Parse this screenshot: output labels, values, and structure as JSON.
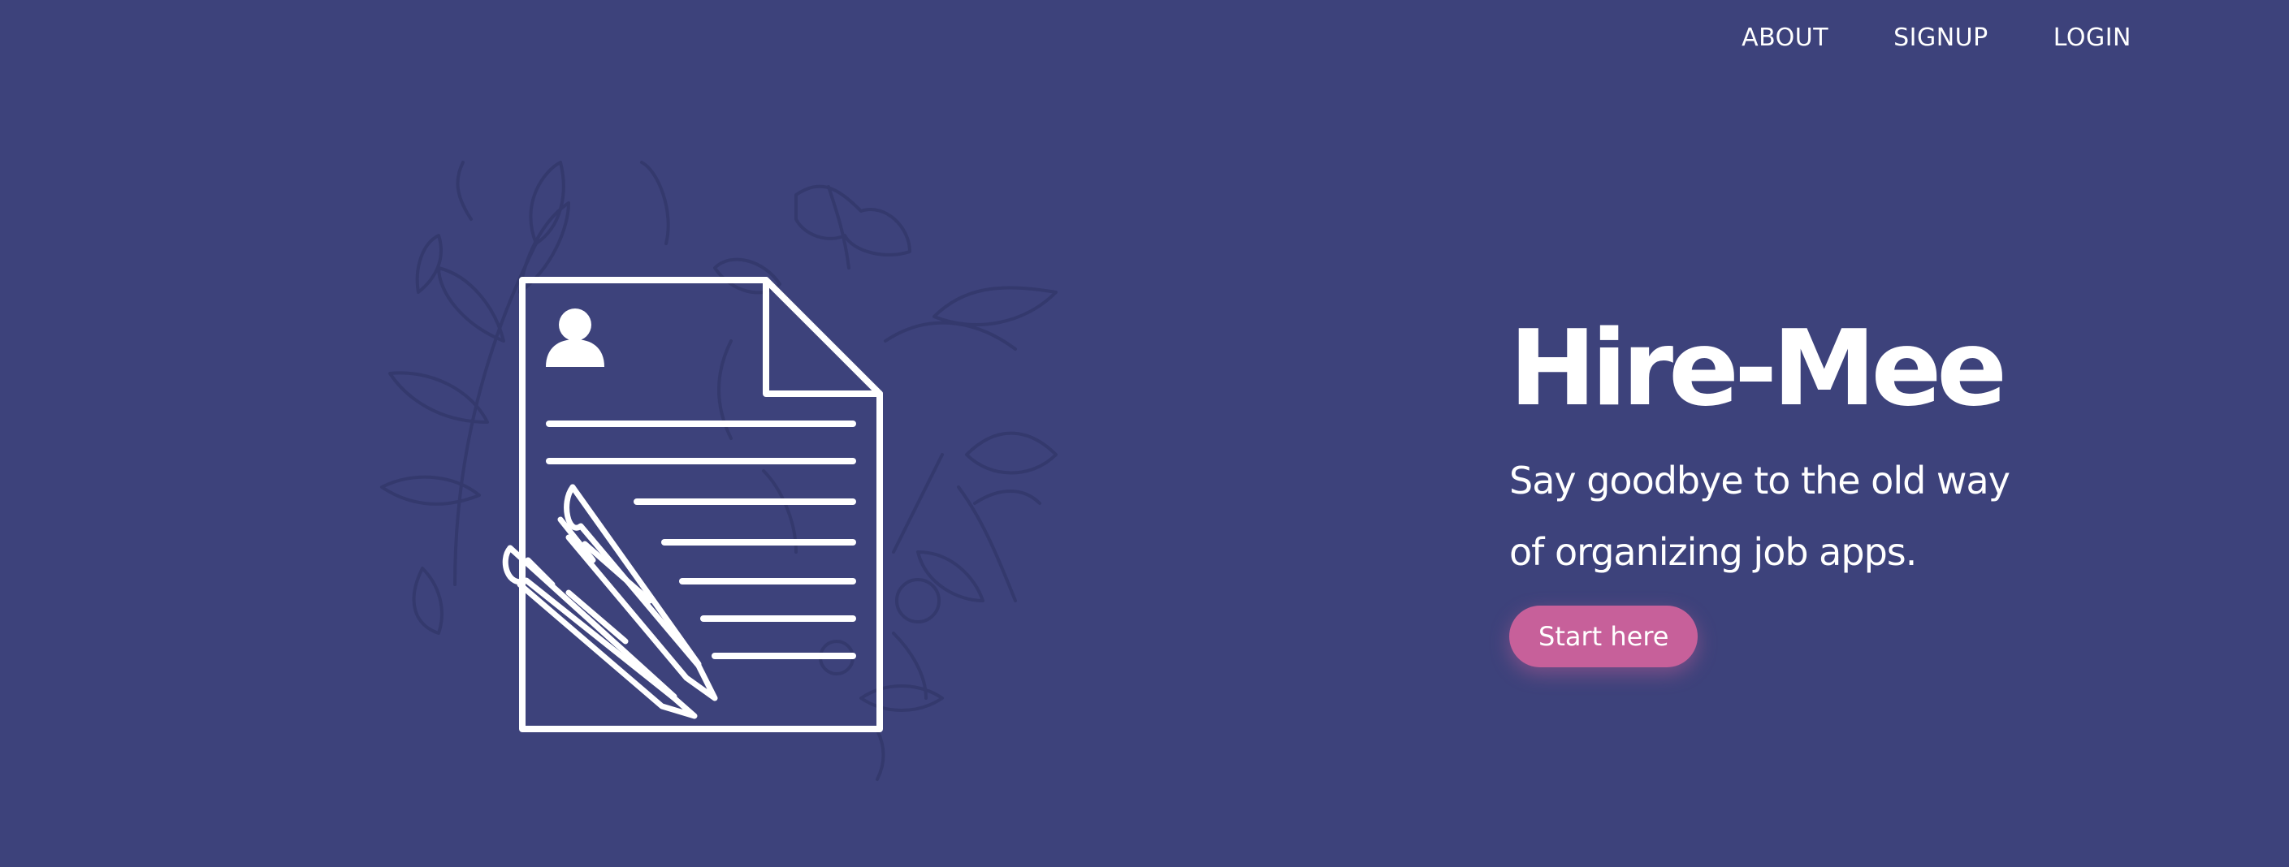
{
  "nav": {
    "items": [
      {
        "label": "ABOUT"
      },
      {
        "label": "SIGNUP"
      },
      {
        "label": "LOGIN"
      }
    ]
  },
  "hero": {
    "title": "Hire-Mee",
    "subtitle_line1": "Say goodbye to the old way",
    "subtitle_line2": "of organizing job apps.",
    "cta_label": "Start here"
  },
  "colors": {
    "background": "#3d427b",
    "accent": "#c7609a",
    "text": "#ffffff",
    "floral": "#34396d"
  },
  "illustration": {
    "icons": [
      "resume-document-icon",
      "user-avatar-icon",
      "pen-icon",
      "floral-background"
    ]
  }
}
